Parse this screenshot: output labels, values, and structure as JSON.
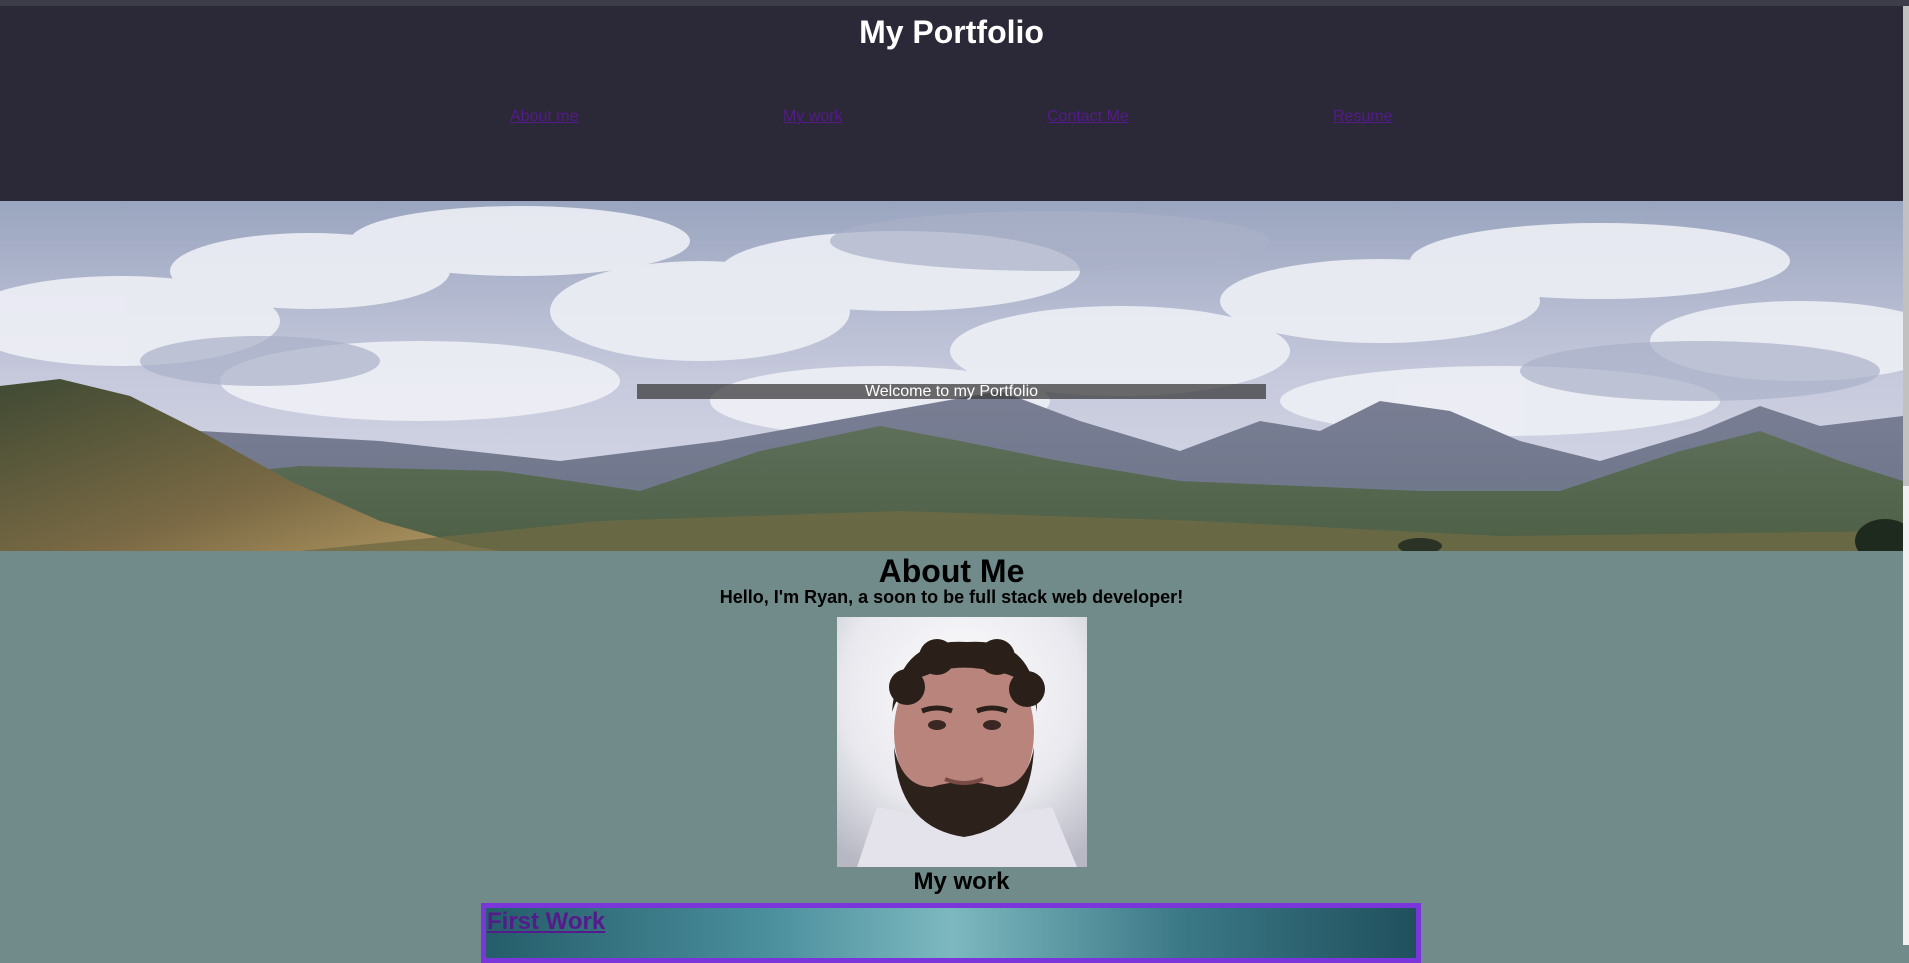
{
  "header": {
    "title": "My Portfolio",
    "nav": [
      {
        "label": "About me"
      },
      {
        "label": "My work"
      },
      {
        "label": "Contact Me"
      },
      {
        "label": "Resume"
      }
    ]
  },
  "hero": {
    "caption": "Welcome to my Portfolio"
  },
  "about": {
    "heading": "About Me",
    "intro": "Hello, I'm Ryan, a soon to be full stack web developer!"
  },
  "work": {
    "heading": "My work",
    "items": [
      {
        "title": "First Work"
      }
    ]
  },
  "colors": {
    "header_bg": "#2b2838",
    "page_bg": "#718a8a",
    "link": "#551a8b",
    "card_border": "#7a35db"
  }
}
